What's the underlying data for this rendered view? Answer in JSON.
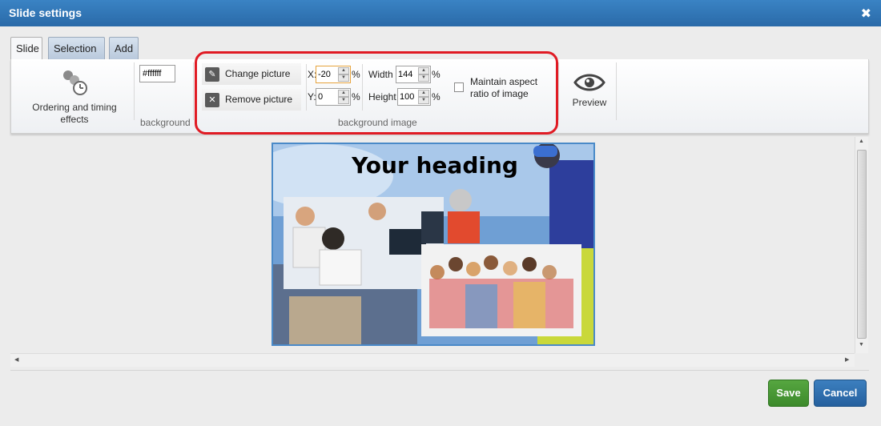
{
  "window": {
    "title": "Slide settings",
    "close_glyph": "✖"
  },
  "tabs": [
    {
      "label": "Slide",
      "active": true
    },
    {
      "label": "Selection",
      "active": false
    },
    {
      "label": "Add",
      "active": false
    }
  ],
  "ribbon": {
    "ordering": {
      "label_line1": "Ordering and timing",
      "label_line2": "effects",
      "icon": "ordering-timing-icon"
    },
    "background": {
      "color_value": "#ffffff",
      "group_label": "background"
    },
    "background_image": {
      "change_label": "Change picture",
      "remove_label": "Remove picture",
      "x_label": "X:",
      "x_value": "-20",
      "y_label": "Y:",
      "y_value": "0",
      "width_label": "Width",
      "width_value": "144",
      "height_label": "Height",
      "height_value": "100",
      "percent": "%",
      "maintain_line1": "Maintain aspect",
      "maintain_line2": "ratio of image",
      "maintain_checked": false,
      "group_label": "background image"
    },
    "preview_label": "Preview"
  },
  "slide": {
    "heading": "Your heading"
  },
  "footer": {
    "save_label": "Save",
    "cancel_label": "Cancel"
  },
  "colors": {
    "accent_blue": "#2a6aa8",
    "save_green": "#3c8a2b",
    "highlight_red": "#e01b24"
  }
}
